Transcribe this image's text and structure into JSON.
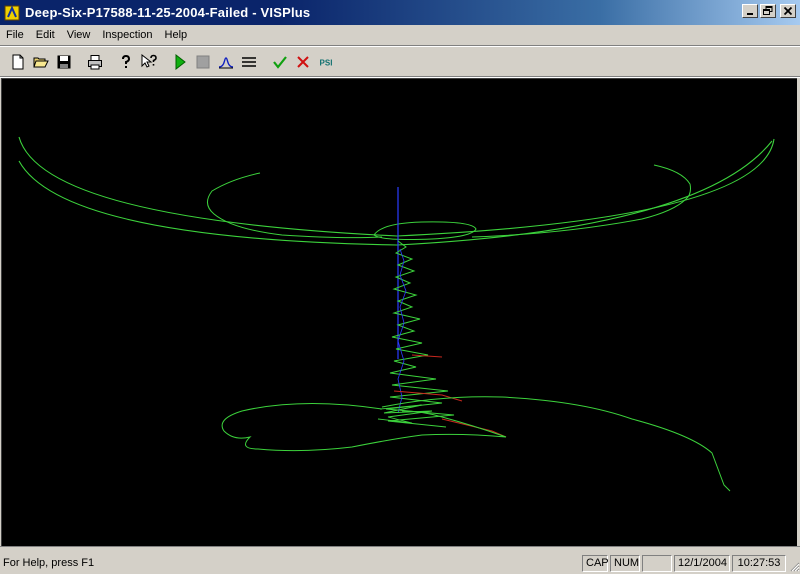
{
  "window": {
    "title": "Deep-Six-P17588-11-25-2004-Failed - VISPlus",
    "app_icon": "visplus-app-icon"
  },
  "window_controls": [
    "minimize-icon",
    "restore-icon",
    "close-icon"
  ],
  "menu": {
    "file": "File",
    "edit": "Edit",
    "view": "View",
    "inspection": "Inspection",
    "help": "Help"
  },
  "toolbar": {
    "buttons": [
      {
        "name": "new-document",
        "icon": "new-document-icon"
      },
      {
        "name": "open-folder",
        "icon": "open-folder-icon"
      },
      {
        "name": "save",
        "icon": "floppy-disk-icon"
      },
      {
        "name": "print",
        "icon": "printer-icon"
      },
      {
        "name": "about",
        "icon": "question-mark-icon"
      },
      {
        "name": "context-help",
        "icon": "pointer-help-icon"
      },
      {
        "name": "play",
        "icon": "play-icon"
      },
      {
        "name": "stop",
        "icon": "stop-icon"
      },
      {
        "name": "waveform",
        "icon": "waveform-icon"
      },
      {
        "name": "lines",
        "icon": "horizontal-lines-icon"
      },
      {
        "name": "accept",
        "icon": "check-icon"
      },
      {
        "name": "reject",
        "icon": "x-icon"
      },
      {
        "name": "psi",
        "icon": "psi-icon",
        "label": "PSI"
      }
    ]
  },
  "colors": {
    "viewport_bg": "#000000",
    "trace_green": "#3cd23c",
    "axis_blue": "#2a3cff",
    "trace_red": "#c8281e"
  },
  "status": {
    "message": "For Help, press F1",
    "cap": "CAP",
    "num": "NUM",
    "scrl": "",
    "date": "12/1/2004",
    "time": "10:27:53"
  }
}
